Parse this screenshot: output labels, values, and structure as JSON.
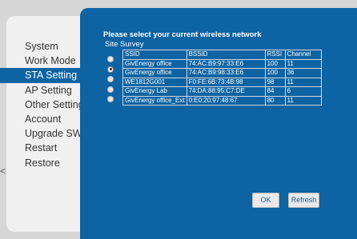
{
  "sidebar": {
    "items": [
      {
        "label": "System"
      },
      {
        "label": "Work Mode"
      },
      {
        "label": "STA Setting"
      },
      {
        "label": "AP Setting"
      },
      {
        "label": "Other Setting"
      },
      {
        "label": "Account"
      },
      {
        "label": "Upgrade SW"
      },
      {
        "label": "Restart"
      },
      {
        "label": "Restore"
      }
    ],
    "active_index": 2,
    "edge_mark": "<"
  },
  "main": {
    "heading": "Please select your current wireless network",
    "survey_label": "Site Survey",
    "table": {
      "headers": [
        "SSID",
        "BSSID",
        "RSSI",
        "Channel"
      ],
      "rows": [
        {
          "ssid": "GivEnergy office",
          "bssid": "74:AC:B9:97:33:E6",
          "rssi": "100",
          "channel": "11"
        },
        {
          "ssid": "GivEnergy office",
          "bssid": "74:AC:B9:98:33:E6",
          "rssi": "100",
          "channel": "36"
        },
        {
          "ssid": "WE1812G001",
          "bssid": "F0:FE:6B:73:4B:98",
          "rssi": "98",
          "channel": "11"
        },
        {
          "ssid": "GivEnergy Lab",
          "bssid": "74:DA:88:95:C7:DE",
          "rssi": "84",
          "channel": "6"
        },
        {
          "ssid": "GivEnergy office_Ext",
          "bssid": "0:E0:20:97:48:67",
          "rssi": "80",
          "channel": "11"
        }
      ]
    },
    "selected_row": 1,
    "buttons": {
      "ok_label": "OK",
      "refresh_label": "Refresh"
    }
  },
  "colors": {
    "accent": "#0e63a2",
    "sidebar_bg": "#f0f0f0",
    "page_bg": "#d6d6d6"
  }
}
